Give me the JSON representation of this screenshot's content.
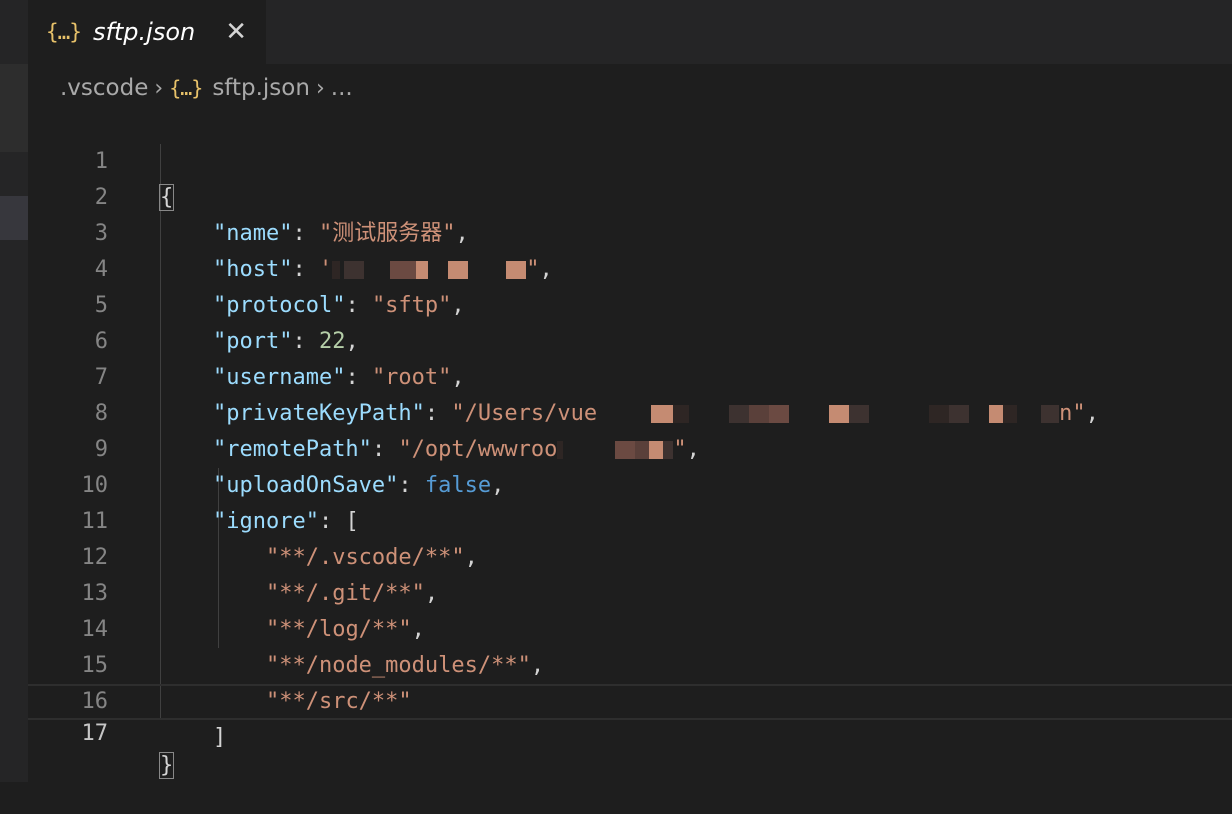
{
  "tab": {
    "icon": "{…}",
    "title": "sftp.json"
  },
  "breadcrumb": {
    "folder": ".vscode",
    "file_icon": "{…}",
    "file": "sftp.json",
    "ellipsis": "..."
  },
  "editor": {
    "current_line": 17,
    "lines": [
      {
        "n": "1"
      },
      {
        "n": "2",
        "key": "\"name\"",
        "value": "\"测试服务器\""
      },
      {
        "n": "3",
        "key": "\"host\"",
        "value_start": "'",
        "value_end": "\""
      },
      {
        "n": "4",
        "key": "\"protocol\"",
        "value": "\"sftp\""
      },
      {
        "n": "5",
        "key": "\"port\"",
        "value": "22"
      },
      {
        "n": "6",
        "key": "\"username\"",
        "value": "\"root\""
      },
      {
        "n": "7",
        "key": "\"privateKeyPath\"",
        "value_start": "\"/Users/vue",
        "value_end": "n\""
      },
      {
        "n": "8",
        "key": "\"remotePath\"",
        "value_start": "\"/opt/wwwroo",
        "value_end": "\""
      },
      {
        "n": "9",
        "key": "\"uploadOnSave\"",
        "value": "false"
      },
      {
        "n": "10",
        "key": "\"ignore\"",
        "value": "["
      },
      {
        "n": "11",
        "value": "\"**/.vscode/**\""
      },
      {
        "n": "12",
        "value": "\"**/.git/**\""
      },
      {
        "n": "13",
        "value": "\"**/log/**\""
      },
      {
        "n": "14",
        "value": "\"**/node_modules/**\""
      },
      {
        "n": "15",
        "value": "\"**/src/**\""
      },
      {
        "n": "16",
        "value": "]"
      },
      {
        "n": "17"
      }
    ]
  },
  "colors": {
    "key": "#9cdcfe",
    "string": "#ce9178",
    "number": "#b5cea8",
    "keyword": "#569cd6",
    "json_icon": "#e8c26a"
  }
}
